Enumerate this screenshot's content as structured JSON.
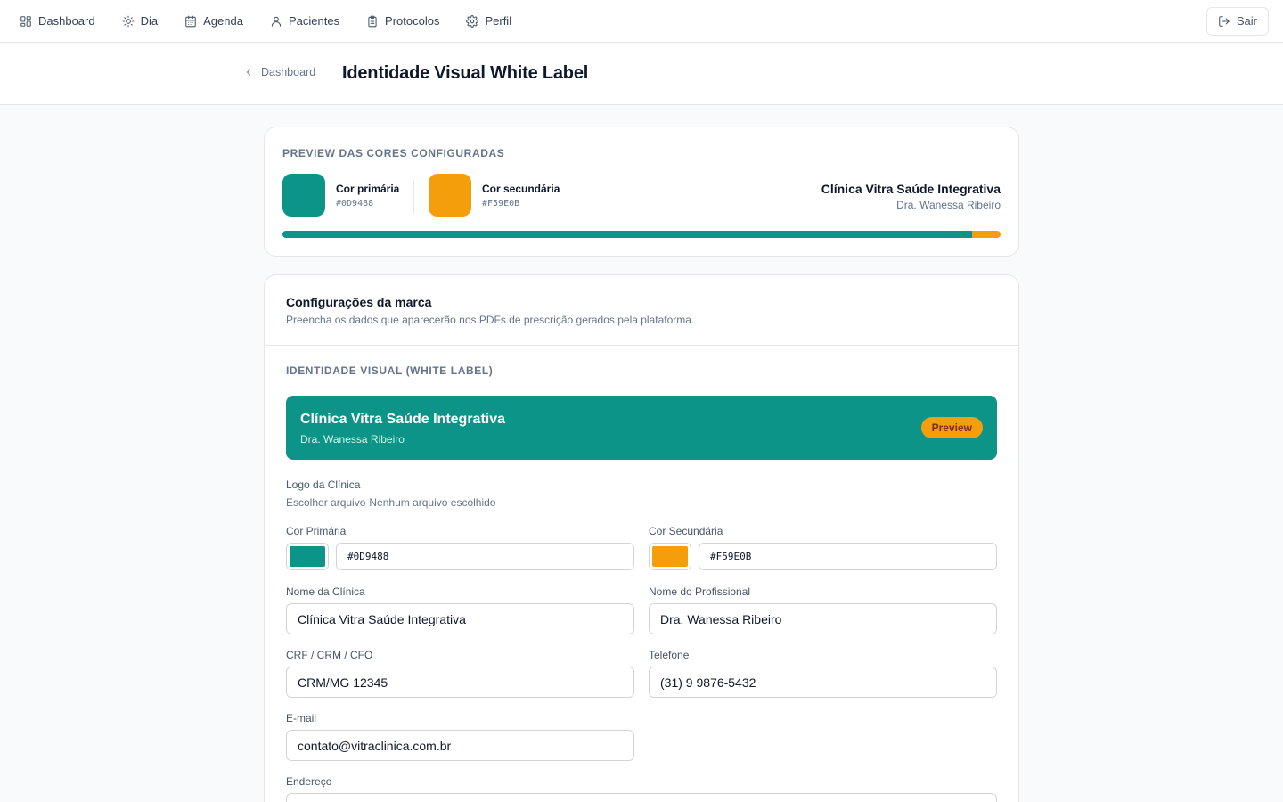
{
  "nav": {
    "items": [
      {
        "label": "Dashboard",
        "icon": "grid-icon"
      },
      {
        "label": "Dia",
        "icon": "sun-icon"
      },
      {
        "label": "Agenda",
        "icon": "calendar-icon"
      },
      {
        "label": "Pacientes",
        "icon": "user-icon"
      },
      {
        "label": "Protocolos",
        "icon": "clipboard-icon"
      },
      {
        "label": "Perfil",
        "icon": "gear-icon"
      }
    ],
    "logout_label": "Sair"
  },
  "header": {
    "back_label": "Dashboard",
    "title": "Identidade Visual White Label"
  },
  "preview": {
    "section_label": "PREVIEW DAS CORES CONFIGURADAS",
    "primary_name": "Cor primária",
    "primary_hex": "#0D9488",
    "secondary_name": "Cor secundária",
    "secondary_hex": "#F59E0B",
    "clinic_name": "Clínica Vitra Saúde Integrativa",
    "professional_name": "Dra. Wanessa Ribeiro",
    "bar_primary_fraction": 0.96
  },
  "config": {
    "title": "Configurações da marca",
    "subtitle": "Preencha os dados que aparecerão nos PDFs de prescrição gerados pela plataforma.",
    "section_label": "IDENTIDADE VISUAL (WHITE LABEL)",
    "banner": {
      "clinic_name": "Clínica Vitra Saúde Integrativa",
      "professional_name": "Dra. Wanessa Ribeiro",
      "badge": "Preview"
    },
    "logo_label": "Logo da Clínica",
    "file_button": "Escolher arquivo",
    "file_status": "Nenhum arquivo escolhido",
    "primary_label": "Cor Primária",
    "primary_value": "#0D9488",
    "secondary_label": "Cor Secundária",
    "secondary_value": "#F59E0B",
    "clinic_label": "Nome da Clínica",
    "clinic_value": "Clínica Vitra Saúde Integrativa",
    "professional_label": "Nome do Profissional",
    "professional_value": "Dra. Wanessa Ribeiro",
    "registry_label": "CRF / CRM / CFO",
    "registry_value": "CRM/MG 12345",
    "phone_label": "Telefone",
    "phone_value": "(31) 9 9876-5432",
    "email_label": "E-mail",
    "email_value": "contato@vitraclinica.com.br",
    "address_label": "Endereço"
  },
  "colors": {
    "primary": "#0D9488",
    "secondary": "#F59E0B"
  }
}
